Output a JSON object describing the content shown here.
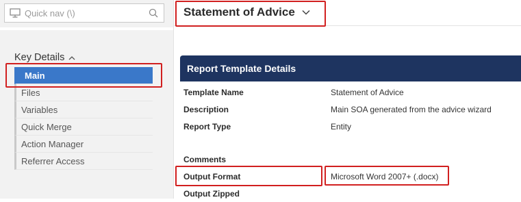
{
  "sidebar": {
    "quick_nav": {
      "placeholder": "Quick nav (\\)"
    },
    "section_title": "Key Details",
    "items": [
      {
        "label": "Main",
        "active": true
      },
      {
        "label": "Files"
      },
      {
        "label": "Variables"
      },
      {
        "label": "Quick Merge"
      },
      {
        "label": "Action Manager"
      },
      {
        "label": "Referrer Access"
      }
    ]
  },
  "header": {
    "title": "Statement of Advice"
  },
  "panel": {
    "title": "Report Template Details",
    "rows": [
      {
        "label": "Template Name",
        "value": "Statement of Advice"
      },
      {
        "label": "Description",
        "value": "Main SOA generated from the advice wizard"
      },
      {
        "label": "Report Type",
        "value": "Entity"
      },
      {
        "label": "Comments",
        "value": ""
      },
      {
        "label": "Output Format",
        "value": "Microsoft Word 2007+ (.docx)"
      },
      {
        "label": "Output Zipped",
        "value": ""
      }
    ]
  },
  "colors": {
    "accent": "#3a78c9",
    "panel_header": "#1e3460",
    "highlight": "#d11f1f"
  }
}
